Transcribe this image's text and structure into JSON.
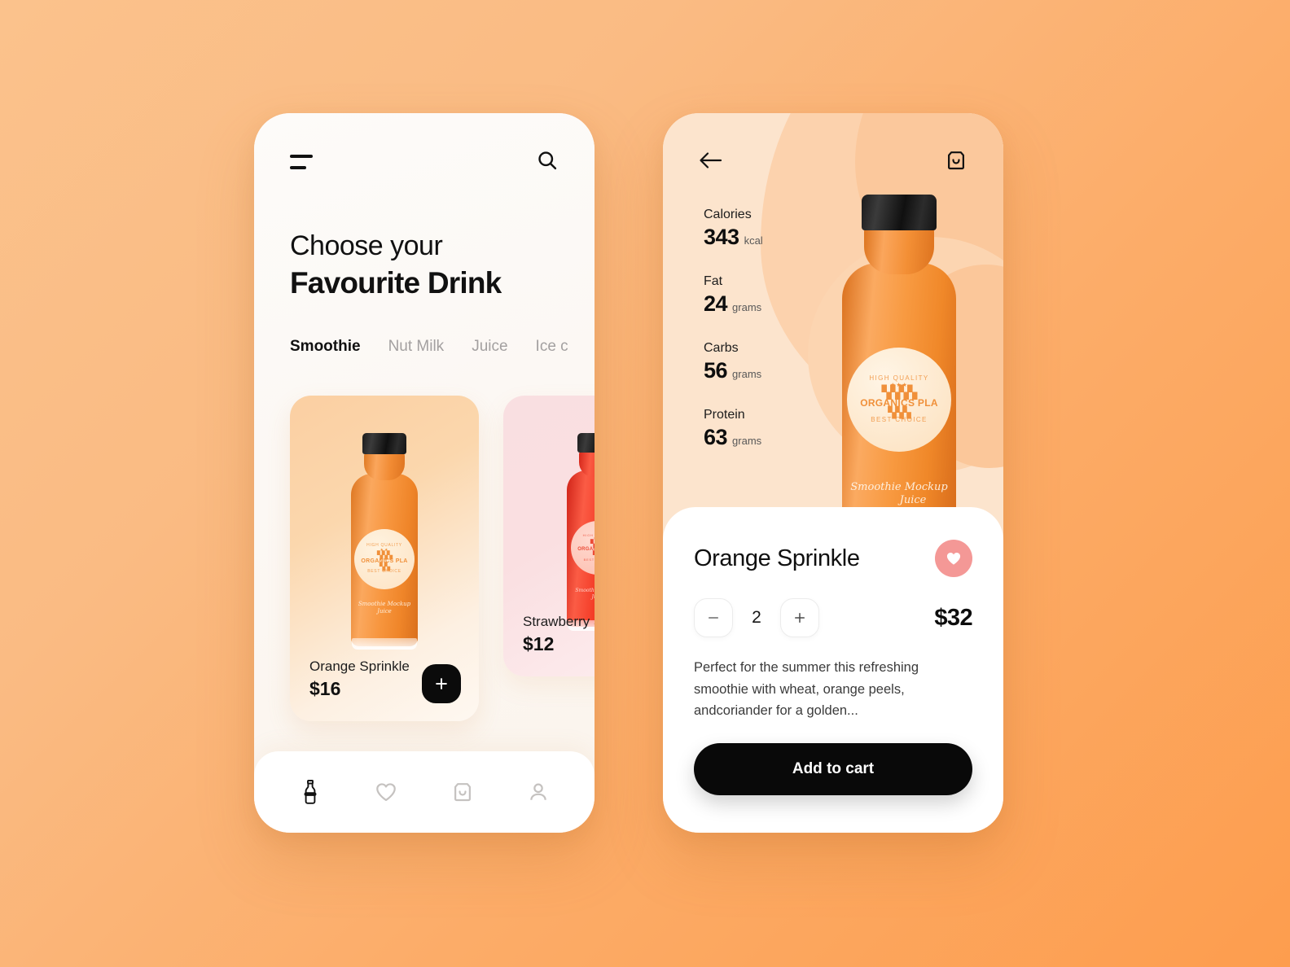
{
  "theme": {
    "bg_gradient_start": "#FBC28C",
    "bg_gradient_end": "#FD9D4E",
    "accent_dark": "#0B0B0B",
    "favorite_pink": "#F49896",
    "card_orange": "#FBCFA2",
    "card_pink": "#F9DFE1"
  },
  "left_screen": {
    "topbar": {
      "menu_icon": "hamburger-icon",
      "search_icon": "search-icon"
    },
    "heading": {
      "line1": "Choose your",
      "line2": "Favourite Drink"
    },
    "tabs": [
      {
        "label": "Smoothie",
        "active": true
      },
      {
        "label": "Nut Milk",
        "active": false
      },
      {
        "label": "Juice",
        "active": false
      },
      {
        "label": "Ice c",
        "active": false
      }
    ],
    "products": [
      {
        "name": "Orange Sprinkle",
        "price": "$16",
        "add_label": "+",
        "bottle_color": "orange"
      },
      {
        "name": "Strawberry Sp",
        "price": "$12",
        "bottle_color": "red"
      }
    ],
    "bottom_nav": [
      {
        "icon": "bottle-icon",
        "active": true
      },
      {
        "icon": "heart-icon",
        "active": false
      },
      {
        "icon": "shopping-bag-icon",
        "active": false
      },
      {
        "icon": "person-icon",
        "active": false
      }
    ]
  },
  "right_screen": {
    "topbar": {
      "back_icon": "back-arrow-icon",
      "cart_icon": "shopping-bag-icon"
    },
    "nutrition": [
      {
        "label": "Calories",
        "value": "343",
        "unit": "kcal"
      },
      {
        "label": "Fat",
        "value": "24",
        "unit": "grams"
      },
      {
        "label": "Carbs",
        "value": "56",
        "unit": "grams"
      },
      {
        "label": "Protein",
        "value": "63",
        "unit": "grams"
      }
    ],
    "bottle_label": {
      "top": "HIGH QUALITY",
      "middle": "ORGANICS PLA",
      "bottom": "BEST CHOICE",
      "script_line1": "Smoothie Mockup",
      "script_line2": "Juice"
    },
    "detail": {
      "title": "Orange Sprinkle",
      "favorite_icon": "heart-icon",
      "decrement_label": "−",
      "quantity": "2",
      "increment_label": "+",
      "price": "$32",
      "description": "Perfect for the summer this refreshing smoothie with wheat, orange peels, andcoriander for a golden...",
      "add_to_cart_label": "Add to cart"
    }
  }
}
